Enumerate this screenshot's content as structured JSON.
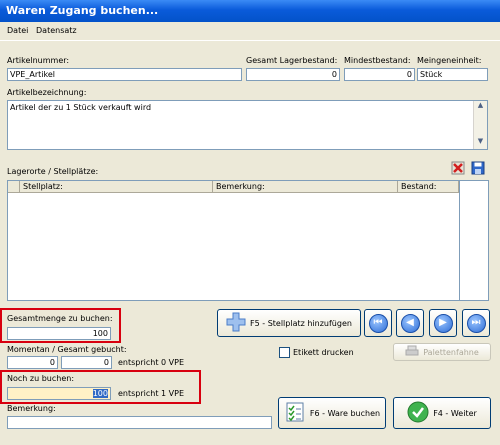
{
  "window": {
    "title": "Waren Zugang buchen..."
  },
  "menu": {
    "items": [
      "Datei",
      "Datensatz"
    ]
  },
  "article": {
    "number_label": "Artikelnummer:",
    "number_value": "VPE_Artikel",
    "total_stock_label": "Gesamt Lagerbestand:",
    "total_stock_value": "0",
    "min_stock_label": "Mindestbestand:",
    "min_stock_value": "0",
    "unit_label": "Meingeneinheit:",
    "unit_value": "Stück",
    "description_label": "Artikelbezeichnung:",
    "description_value": "Artikel der zu 1 Stück verkauft wird"
  },
  "storage": {
    "section_label": "Lagerorte / Stellplätze:",
    "columns": [
      "Stellplatz:",
      "Bemerkung:",
      "Bestand:"
    ]
  },
  "booking": {
    "total_qty_label": "Gesamtmenge zu buchen:",
    "total_qty_value": "100",
    "current_total_label": "Momentan / Gesamt gebucht:",
    "current_value": "0",
    "total_value": "0",
    "current_vpe_text": "entspricht 0 VPE",
    "remaining_label": "Noch zu buchen:",
    "remaining_value": "100",
    "remaining_vpe_text": "entspricht 1 VPE",
    "remark_label": "Bemerkung:",
    "remark_value": ""
  },
  "actions": {
    "add_location": "F5 - Stellplatz hinzufügen",
    "label_checkbox": "Etikett drucken",
    "pallet_flag": "Palettenfahne",
    "book_goods": "F6 - Ware buchen",
    "next": "F4 - Weiter"
  },
  "nav_glyphs": {
    "first": "⏮",
    "prev": "◀",
    "next": "▶",
    "last": "⏭"
  },
  "icons": {
    "delete": "delete-icon",
    "save": "save-icon"
  },
  "colors": {
    "title_bar": "#0A5BDA",
    "highlight_box": "#D8000F",
    "active_field": "#FFF1C6"
  }
}
